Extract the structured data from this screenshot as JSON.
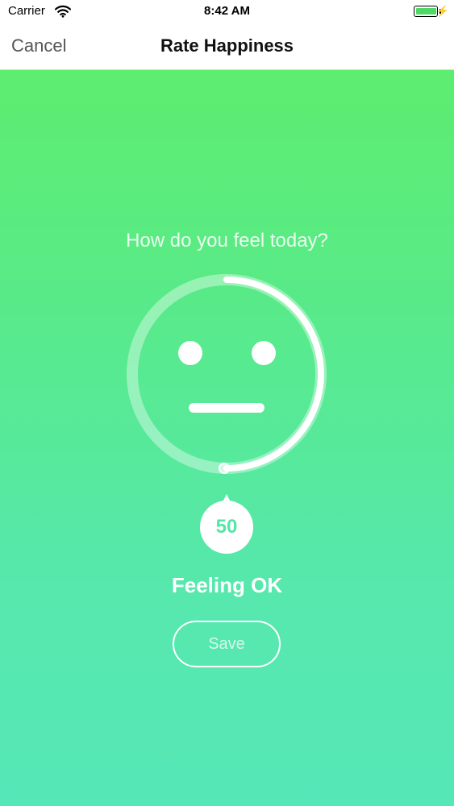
{
  "status_bar": {
    "carrier": "Carrier",
    "time": "8:42 AM",
    "battery_color": "#4cd964",
    "icons": [
      "wifi-icon",
      "battery-icon",
      "charging-bolt-icon"
    ]
  },
  "nav": {
    "cancel_label": "Cancel",
    "title": "Rate Happiness"
  },
  "rating": {
    "question": "How do you feel today?",
    "value": "50",
    "progress_fraction": 0.5,
    "feeling_label": "Feeling OK",
    "save_label": "Save",
    "face_icon": "smiley-face-icon"
  },
  "colors": {
    "gradient_top": "#5ded6f",
    "gradient_bottom": "#56e7b8",
    "accent": "#55e6a7"
  }
}
